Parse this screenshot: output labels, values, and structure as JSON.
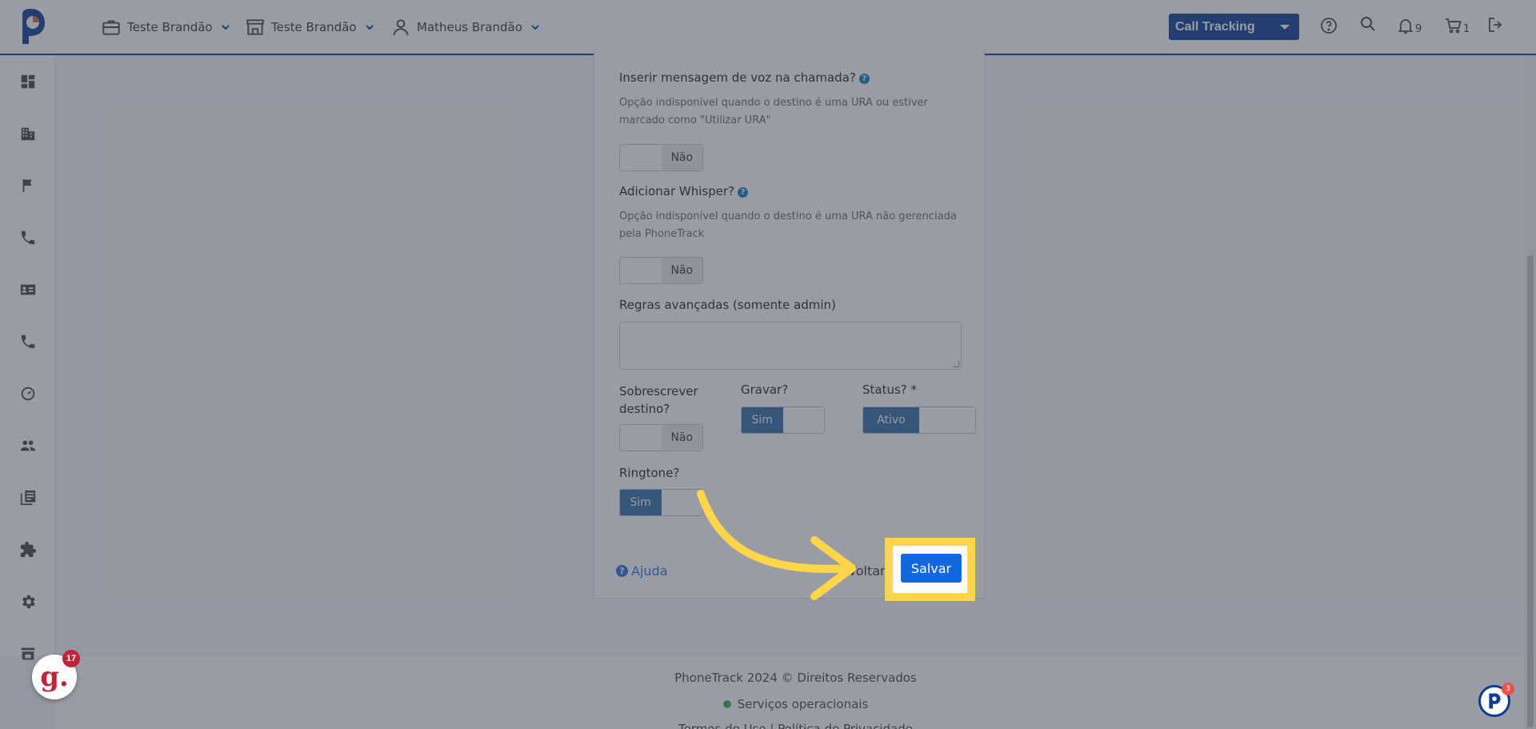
{
  "header": {
    "account": "Teste Brandão",
    "store": "Teste Brandão",
    "user": "Matheus Brandão",
    "product_select": "Call Tracking",
    "notifications_count": "9",
    "cart_count": "1"
  },
  "sidebar": {
    "items": [
      "dashboard-icon",
      "building-icon",
      "flag-icon",
      "phone-icon",
      "contact-card-icon",
      "phone-icon",
      "speed-icon",
      "users-icon",
      "library-icon",
      "puzzle-icon",
      "gear-icon",
      "store-icon"
    ]
  },
  "form": {
    "voice_message_label": "Inserir mensagem de voz na chamada?",
    "voice_message_desc": "Opção indisponível quando o destino é uma URA ou estiver marcado como \"Utilizar URA\"",
    "voice_message_value": "Não",
    "whisper_label": "Adicionar Whisper?",
    "whisper_desc": "Opção indisponível quando o destino é uma URA não gerenciada pela PhoneTrack",
    "whisper_value": "Não",
    "advanced_rules_label": "Regras avançadas (somente admin)",
    "overwrite_label": "Sobrescrever destino?",
    "overwrite_value": "Não",
    "record_label": "Gravar?",
    "record_value": "Sim",
    "status_label": "Status? *",
    "status_value": "Ativo",
    "ringtone_label": "Ringtone?",
    "ringtone_value": "Sim",
    "help_link": "Ajuda",
    "back_link": "Voltar",
    "save_button": "Salvar"
  },
  "footer": {
    "copyright": "PhoneTrack 2024 © Direitos Reservados",
    "status": "Serviços operacionais",
    "links": "Termos de Uso | Política de Privacidade"
  },
  "widgets": {
    "g_badge_count": "17",
    "chat_badge_count": "3"
  },
  "colors": {
    "brand": "#0a3d91",
    "primary_button": "#1168e0",
    "toggle_on": "#2e6da4",
    "highlight": "#ffd54a"
  }
}
